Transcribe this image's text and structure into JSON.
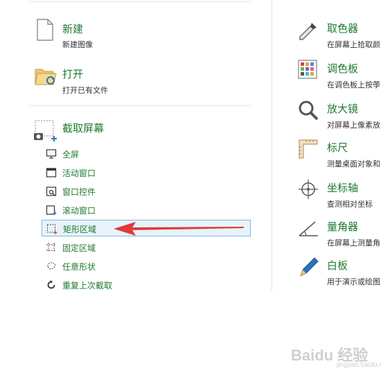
{
  "left": {
    "new": {
      "title": "新建",
      "subtitle": "新建图像"
    },
    "open": {
      "title": "打开",
      "subtitle": "打开已有文件"
    },
    "capture": {
      "title": "截取屏幕",
      "items": [
        {
          "label": "全屏",
          "icon": "monitor-icon"
        },
        {
          "label": "活动窗口",
          "icon": "window-icon"
        },
        {
          "label": "窗口控件",
          "icon": "window-control-icon"
        },
        {
          "label": "滚动窗口",
          "icon": "scroll-window-icon"
        },
        {
          "label": "矩形区域",
          "icon": "rectangle-region-icon",
          "selected": true
        },
        {
          "label": "固定区域",
          "icon": "fixed-region-icon"
        },
        {
          "label": "任意形状",
          "icon": "freeform-icon"
        },
        {
          "label": "重复上次截取",
          "icon": "repeat-icon"
        }
      ]
    }
  },
  "tools": [
    {
      "title": "取色器",
      "subtitle": "在屏幕上拾取颜",
      "icon": "eyedropper-icon"
    },
    {
      "title": "调色板",
      "subtitle": "在调色板上按荸",
      "icon": "palette-icon"
    },
    {
      "title": "放大镜",
      "subtitle": "对屏幕上像素放",
      "icon": "magnifier-icon"
    },
    {
      "title": "标尺",
      "subtitle": "测量桌面对象和",
      "icon": "ruler-icon"
    },
    {
      "title": "坐标轴",
      "subtitle": "查测相对坐标",
      "icon": "crosshair-icon"
    },
    {
      "title": "量角器",
      "subtitle": "在屏幕上测量角",
      "icon": "protractor-icon"
    },
    {
      "title": "白板",
      "subtitle": "用于演示或绘图",
      "icon": "pen-icon"
    }
  ],
  "watermark": {
    "brand": "Baidu 经验",
    "url": "jingyan.baidu.com"
  },
  "colors": {
    "accent_green": "#1f7a2f",
    "selection_fill": "#e7f3fb",
    "selection_border": "#7fb8df",
    "arrow": "#e03a3a"
  }
}
